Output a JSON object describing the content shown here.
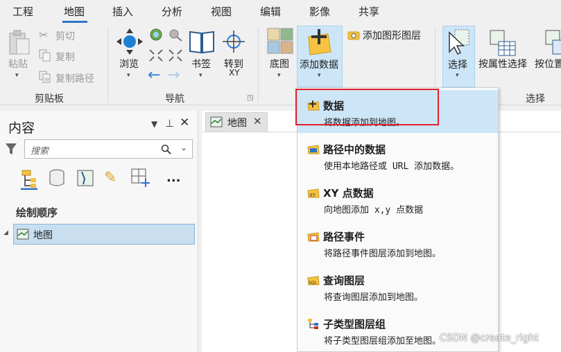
{
  "tabs": [
    "工程",
    "地图",
    "插入",
    "分析",
    "视图",
    "编辑",
    "影像",
    "共享"
  ],
  "active_tab": "地图",
  "clipboard": {
    "paste": "粘贴",
    "cut": "剪切",
    "copy": "复制",
    "copy_path": "复制路径",
    "group_label": "剪贴板"
  },
  "navigation": {
    "browse": "浏览",
    "bookmark": "书签",
    "goto_line1": "转到",
    "goto_line2": "XY",
    "group_label": "导航"
  },
  "layer": {
    "basemap": "底图",
    "add_data": "添加数据",
    "add_graphics_layer": "添加图形图层"
  },
  "selection": {
    "select": "选择",
    "by_attribute": "按属性选择",
    "by_location": "按位置",
    "group_label": "选择"
  },
  "contents": {
    "title": "内容",
    "search_placeholder": "搜索",
    "more": "...",
    "draw_order": "绘制顺序",
    "map_item": "地图"
  },
  "map_tab": {
    "label": "地图"
  },
  "dropdown": {
    "items": [
      {
        "title": "数据",
        "desc": "将数据添加到地图。"
      },
      {
        "title": "路径中的数据",
        "desc": "使用本地路径或 URL 添加数据。"
      },
      {
        "title": "XY 点数据",
        "desc": "向地图添加 x,y 点数据"
      },
      {
        "title": "路径事件",
        "desc": "将路径事件图层添加到地图。"
      },
      {
        "title": "查询图层",
        "desc": "将查询图层添加到地图。"
      },
      {
        "title": "子类型图层组",
        "desc": "将子类型图层组添加至地图。"
      }
    ]
  },
  "watermark": "CSDN @create_right",
  "colors": {
    "accent": "#2e72c7",
    "highlight": "#cde6f7",
    "annotation_red": "#e0202a"
  }
}
